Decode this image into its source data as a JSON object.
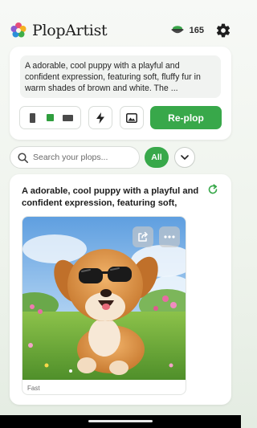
{
  "app": {
    "name": "PlopArtist",
    "credits": "165"
  },
  "prompt": {
    "text": "A adorable, cool puppy with a playful and confident expression, featuring soft, fluffy fur in warm shades of brown and white. The ...",
    "aspect_ratios": [
      "portrait",
      "square",
      "landscape"
    ],
    "selected_aspect": "square",
    "replop_label": "Re-plop"
  },
  "search": {
    "placeholder": "Search your plops...",
    "filter_label": "All"
  },
  "result": {
    "title": "A adorable, cool puppy with a playful and confident expression, featuring soft, fluff...",
    "speed_label": "Fast"
  },
  "colors": {
    "accent": "#38a84a"
  }
}
